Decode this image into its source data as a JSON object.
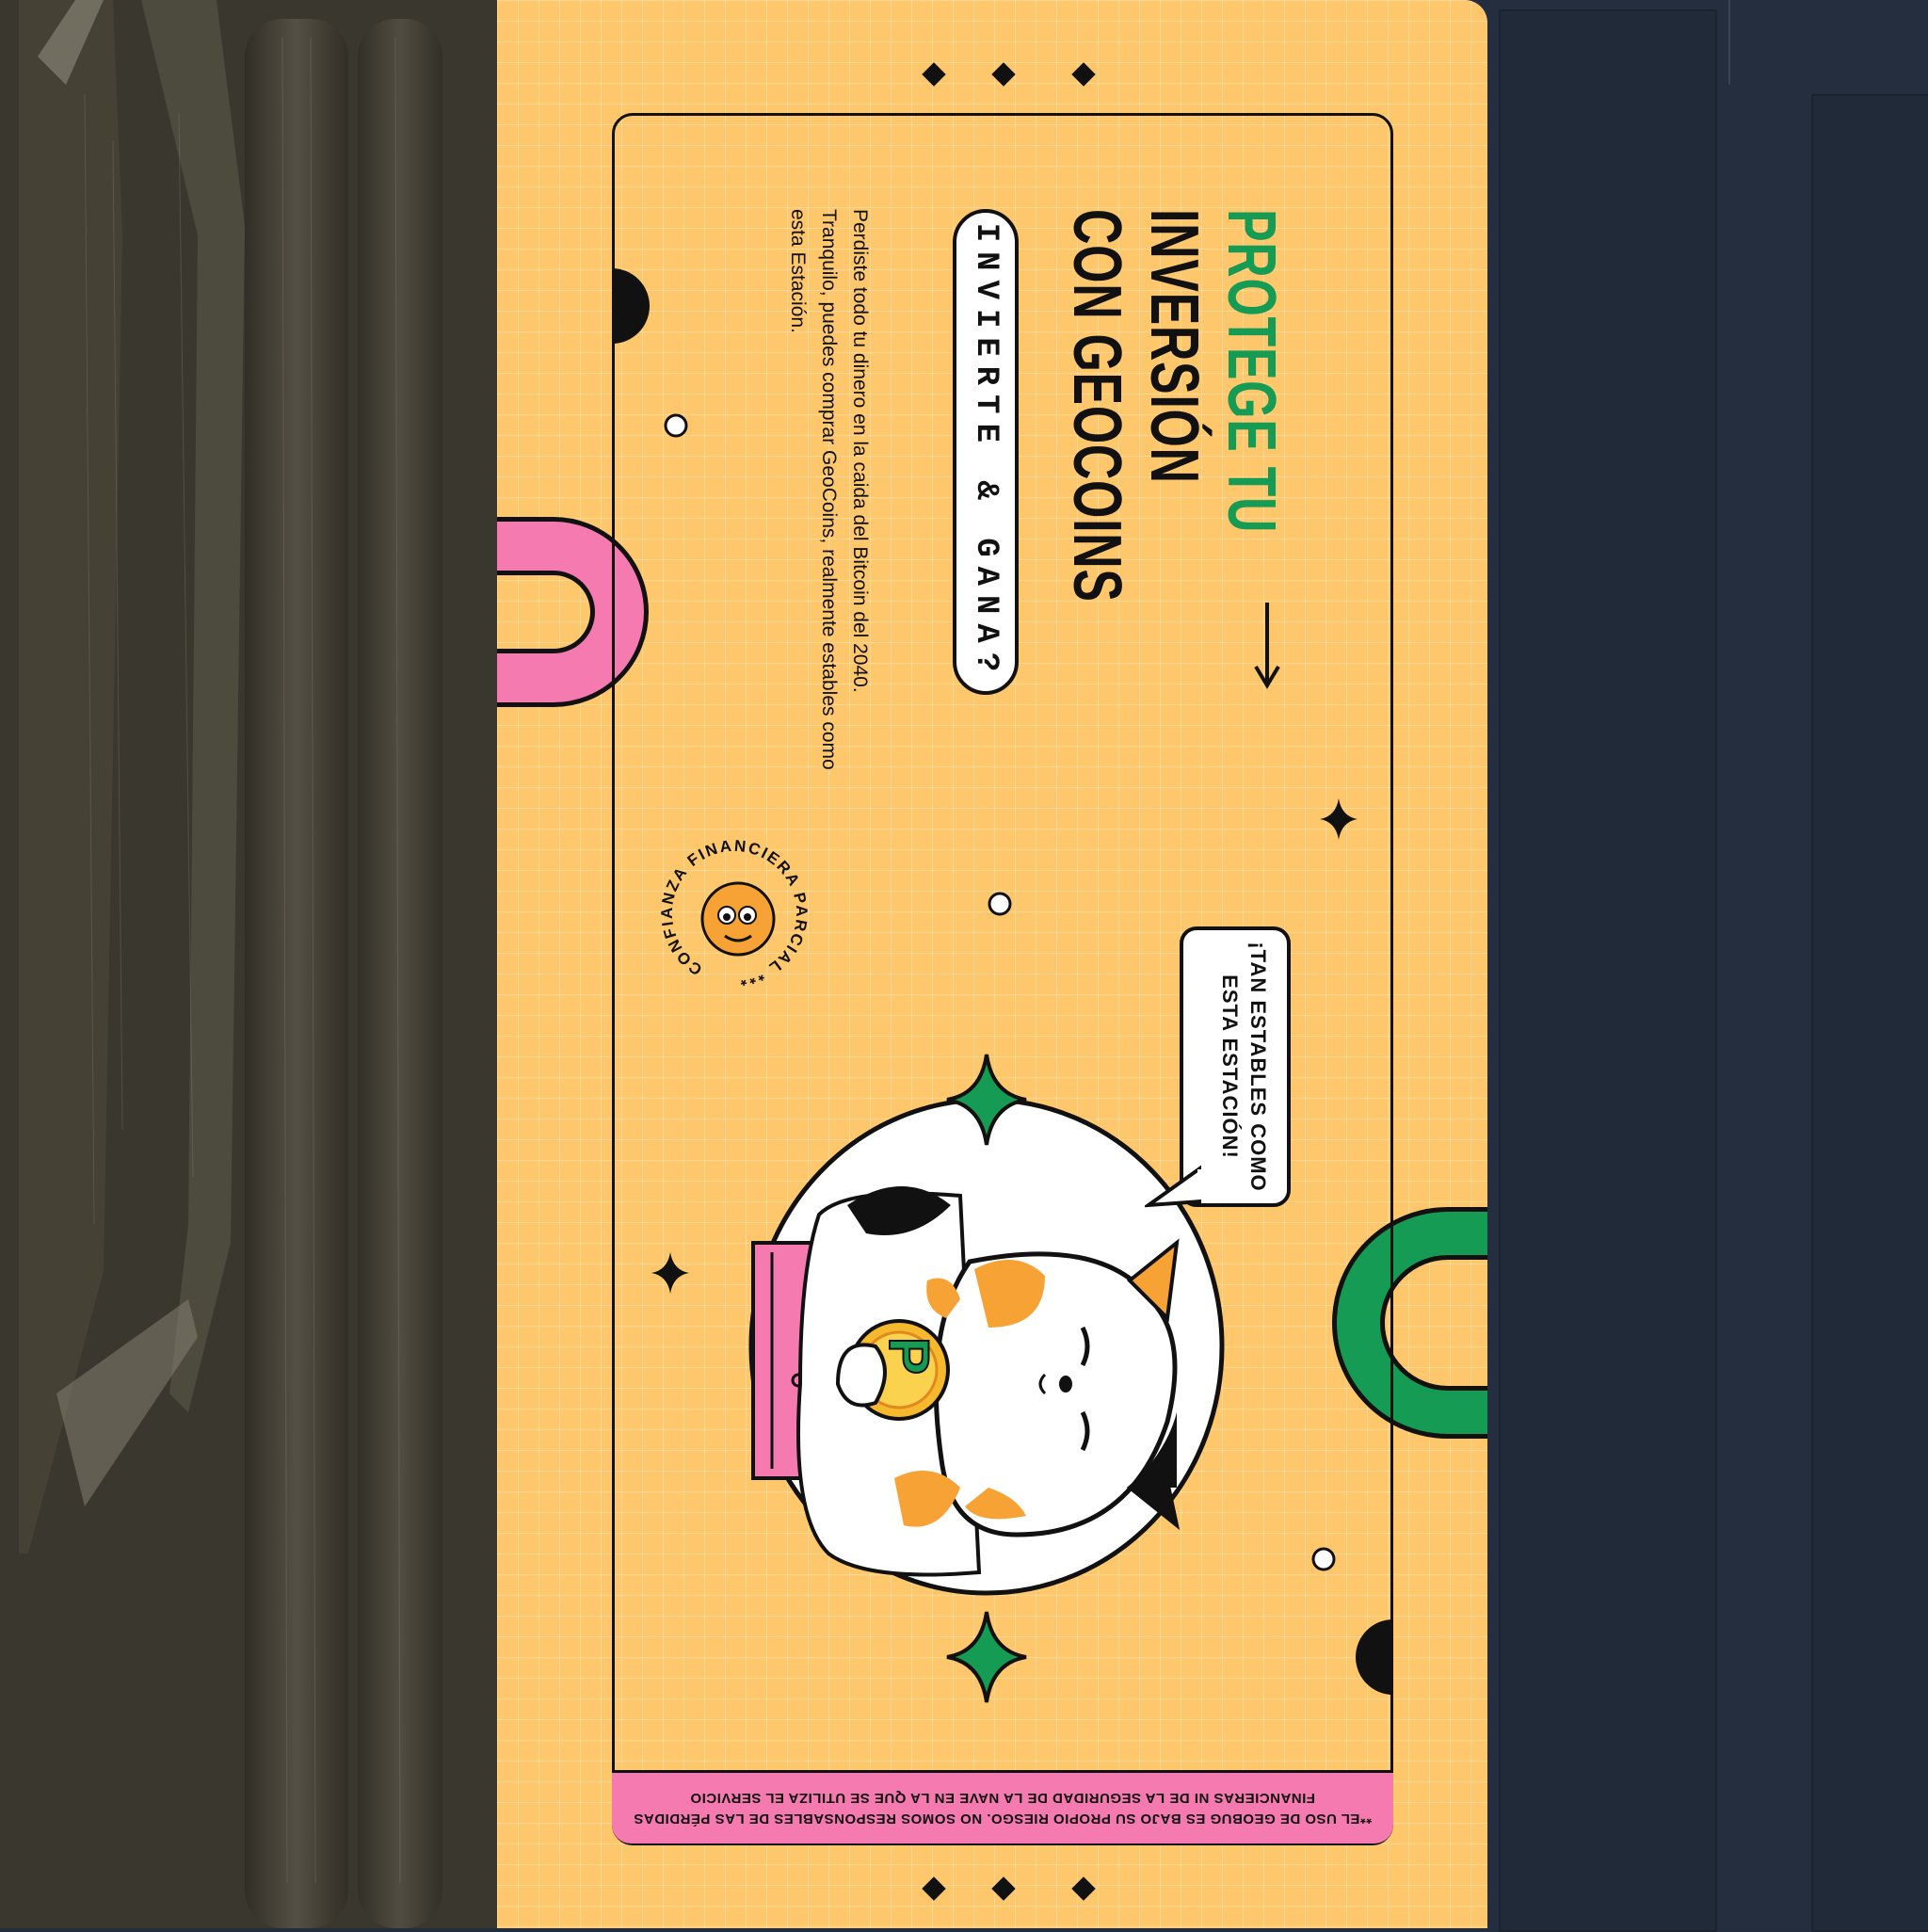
{
  "banner": {
    "title_green": "PROTEGE TU",
    "title_line2": "INVERSIÓN",
    "title_line3": "CON GEOCOINS",
    "cta_pill": "INVIERTE & GANA?",
    "body": "Perdiste todo tu dinero en la caida del Bitcoin del 2040. Tranquilo, puedes comprar GeoCoins, realmente estables como esta Estación.",
    "speech_bubble_line1": "¡TAN ESTABLES COMO",
    "speech_bubble_line2": "ESTA ESTACIÓN!",
    "stamp_text": "CONFIANZA FINANCIERA PARCIAL ***",
    "coin_letter": "P",
    "footer_line1": "**EL USO DE GEOBUG ES BAJO SU PROPIO RIESGO. NO SOMOS RESPONSABLES DE LAS PÉRDIDAS",
    "footer_line2": "FINANCIERAS NI DE LA SEGURIDAD DE LA NAVE EN LA QUE SE UTILIZA EL SERVICIO"
  },
  "colors": {
    "banner_bg": "#fec76c",
    "accent_green": "#159b53",
    "accent_pink": "#f47ab0",
    "ink": "#111111",
    "left_panel": "#3a372e",
    "right_panel": "#252e3e"
  }
}
